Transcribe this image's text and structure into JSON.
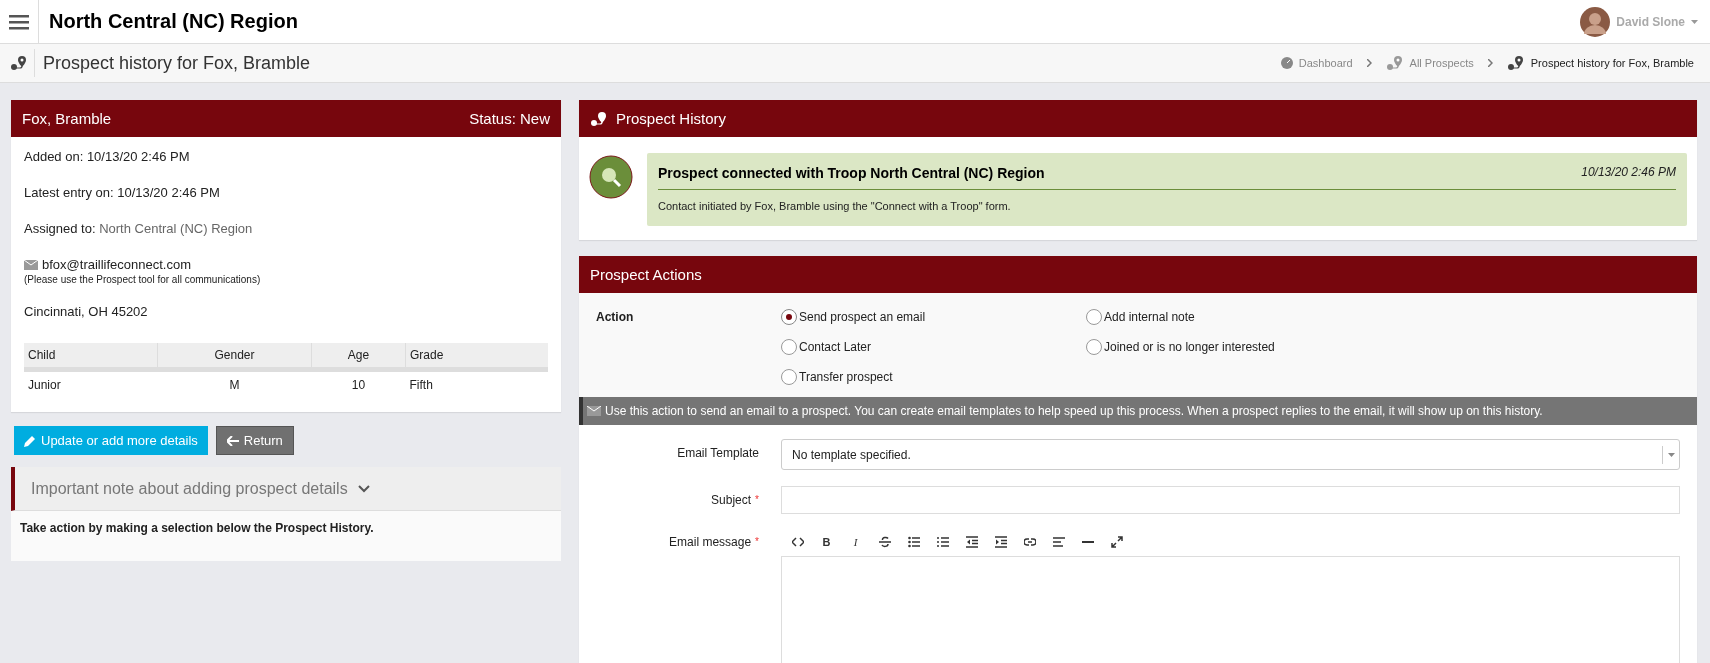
{
  "topbar": {
    "title": "North Central (NC) Region",
    "user": {
      "name": "David Slone"
    }
  },
  "page": {
    "title": "Prospect history for Fox, Bramble",
    "breadcrumbs": [
      {
        "label": "Dashboard",
        "current": false
      },
      {
        "label": "All Prospects",
        "current": false
      },
      {
        "label": "Prospect history for Fox, Bramble",
        "current": true
      }
    ]
  },
  "prospect": {
    "name": "Fox, Bramble",
    "status": "Status: New",
    "added": "Added on: 10/13/20 2:46 PM",
    "latest": "Latest entry on: 10/13/20 2:46 PM",
    "assigned_label": "Assigned to:",
    "assigned_value": "North Central (NC) Region",
    "email": "bfox@traillifeconnect.com",
    "email_note": "(Please use the Prospect tool for all communications)",
    "location": "Cincinnati, OH 45202",
    "table": {
      "columns": [
        "Child",
        "Gender",
        "Age",
        "Grade"
      ],
      "rows": [
        [
          "Junior",
          "M",
          "10",
          "Fifth"
        ]
      ]
    }
  },
  "buttons": [
    {
      "kind": "primary",
      "label": "Update or add more details"
    },
    {
      "kind": "back",
      "label": "Return"
    }
  ],
  "note": {
    "title": "Important note about adding prospect details",
    "expanded": false,
    "body": "Take action by making a selection below the Prospect History."
  },
  "history": {
    "title": "Prospect History",
    "entries": [
      {
        "title": "Prospect connected with Troop North Central (NC) Region",
        "time": "10/13/20 2:46 PM",
        "text": "Contact initiated by Fox, Bramble using the \"Connect with a Troop\" form."
      }
    ]
  },
  "actions": {
    "title": "Prospect Actions",
    "label": "Action",
    "options": [
      {
        "label": "Send prospect an email",
        "selected": true
      },
      {
        "label": "Add internal note",
        "selected": false
      },
      {
        "label": "Contact Later",
        "selected": false
      },
      {
        "label": "Joined or is no longer interested",
        "selected": false
      },
      {
        "label": "Transfer prospect",
        "selected": false
      }
    ],
    "info": "Use this action to send an email to a prospect. You can create email templates to help speed up this process. When a prospect replies to the email, it will show up on this history.",
    "fields": [
      {
        "kind": "select",
        "label": "Email Template",
        "value": "No template specified."
      },
      {
        "kind": "text",
        "label": "Subject",
        "required_mark": "*"
      },
      {
        "kind": "editor",
        "label": "Email message",
        "required_mark": "*",
        "toolbar": {
          "bold": "B",
          "italic": "I"
        }
      }
    ]
  }
}
